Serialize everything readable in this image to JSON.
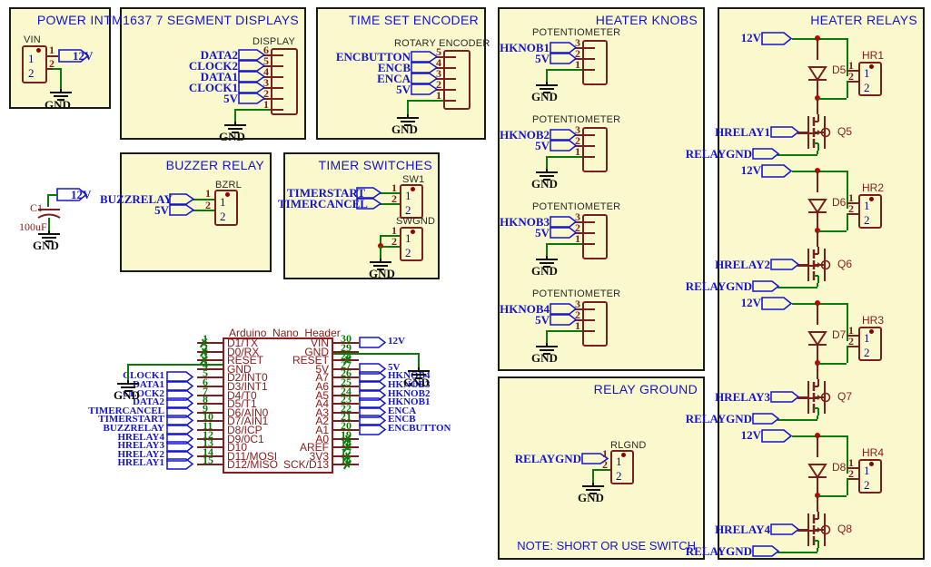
{
  "sheet": {
    "background": "#faf8cd",
    "border_color": "#1a1a1a",
    "net_color": "#1414d2",
    "wire_color": "#0a7a0a",
    "pin_color": "#7a1f1f"
  },
  "blocks": {
    "power_in": {
      "title": "POWER IN",
      "connector": {
        "name": "VIN",
        "pins": [
          "1",
          "2"
        ]
      },
      "nets": [
        "12V"
      ],
      "ground": "GND"
    },
    "displays": {
      "title": "TM1637 7 SEGMENT DISPLAYS",
      "connector": {
        "name": "DISPLAY",
        "pins": [
          "6",
          "5",
          "4",
          "3",
          "2",
          "1"
        ]
      },
      "nets": [
        "DATA2",
        "CLOCK2",
        "DATA1",
        "CLOCK1",
        "5V"
      ],
      "ground": "GND"
    },
    "encoder": {
      "title": "TIME SET ENCODER",
      "connector": {
        "name": "ROTARY ENCODER",
        "pins": [
          "5",
          "4",
          "3",
          "2",
          "1"
        ]
      },
      "nets": [
        "ENCBUTTON",
        "ENCB",
        "ENCA",
        "5V"
      ],
      "ground": "GND"
    },
    "buzzer": {
      "title": "BUZZER RELAY",
      "connector": {
        "name": "BZRL",
        "pins": [
          "1",
          "2"
        ]
      },
      "nets": [
        "BUZZRELAY",
        "5V"
      ]
    },
    "timer_switches": {
      "title": "TIMER SWITCHES",
      "connector_sw1": {
        "name": "SW1",
        "pins": [
          "1",
          "2"
        ]
      },
      "connector_swgnd": {
        "name": "SWGND",
        "pins": [
          "1",
          "2"
        ]
      },
      "nets": [
        "TIMERSTART",
        "TIMERCANCEL"
      ],
      "ground": "GND"
    },
    "decoupling": {
      "cap_ref": "C1",
      "cap_value": "100uF",
      "net": "12V",
      "ground": "GND"
    },
    "heater_knobs": {
      "title": "HEATER KNOBS",
      "device_label": "POTENTIOMETER",
      "pins": [
        "3",
        "2",
        "1"
      ],
      "ground": "GND",
      "supply_net": "5V",
      "pots": [
        {
          "net": "HKNOB1"
        },
        {
          "net": "HKNOB2"
        },
        {
          "net": "HKNOB3"
        },
        {
          "net": "HKNOB4"
        }
      ]
    },
    "relay_ground": {
      "title": "RELAY GROUND",
      "connector": {
        "name": "RLGND",
        "pins": [
          "1",
          "2"
        ]
      },
      "net": "RELAYGND",
      "ground": "GND",
      "note": "NOTE: SHORT OR USE SWITCH"
    },
    "heater_relays": {
      "title": "HEATER RELAYS",
      "supply_net": "12V",
      "ground_net": "RELAYGND",
      "stages": [
        {
          "diode": "D5",
          "mosfet": "Q5",
          "connector": "HR1",
          "gate_net": "HRELAY1",
          "pins": [
            "1",
            "2"
          ]
        },
        {
          "diode": "D6",
          "mosfet": "Q6",
          "connector": "HR2",
          "gate_net": "HRELAY2",
          "pins": [
            "1",
            "2"
          ]
        },
        {
          "diode": "D7",
          "mosfet": "Q7",
          "connector": "HR3",
          "gate_net": "HRELAY3",
          "pins": [
            "1",
            "2"
          ]
        },
        {
          "diode": "D8",
          "mosfet": "Q8",
          "connector": "HR4",
          "gate_net": "HRELAY4",
          "pins": [
            "1",
            "2"
          ]
        }
      ]
    },
    "nano": {
      "title": "Arduino_Nano_Header",
      "left_pins": [
        {
          "num": "1",
          "name": "D1/TX",
          "net": "",
          "nc": true
        },
        {
          "num": "2",
          "name": "D0/RX",
          "net": "",
          "nc": true
        },
        {
          "num": "3",
          "name": "RESET",
          "net": "",
          "nc": true
        },
        {
          "num": "4",
          "name": "GND",
          "net": "GND",
          "nc": false
        },
        {
          "num": "5",
          "name": "D2/INT0",
          "net": "CLOCK1",
          "nc": false
        },
        {
          "num": "6",
          "name": "D3/INT1",
          "net": "DATA1",
          "nc": false
        },
        {
          "num": "7",
          "name": "D4/T0",
          "net": "CLOCK2",
          "nc": false
        },
        {
          "num": "8",
          "name": "D5/T1",
          "net": "DATA2",
          "nc": false
        },
        {
          "num": "9",
          "name": "D6/AIN0",
          "net": "TIMERCANCEL",
          "nc": false
        },
        {
          "num": "10",
          "name": "D7/AIN1",
          "net": "TIMERSTART",
          "nc": false
        },
        {
          "num": "11",
          "name": "D8/ICP",
          "net": "BUZZRELAY",
          "nc": false
        },
        {
          "num": "12",
          "name": "D9/0C1",
          "net": "HRELAY4",
          "nc": false
        },
        {
          "num": "13",
          "name": "D10",
          "net": "HRELAY3",
          "nc": false
        },
        {
          "num": "14",
          "name": "D11/MOSI",
          "net": "HRELAY2",
          "nc": false
        },
        {
          "num": "15",
          "name": "D12/MISO",
          "net": "HRELAY1",
          "nc": false
        }
      ],
      "right_pins": [
        {
          "num": "30",
          "name": "VIN",
          "net": "12V",
          "nc": false
        },
        {
          "num": "29",
          "name": "GND",
          "net": "GND",
          "nc": false
        },
        {
          "num": "28",
          "name": "RESET",
          "net": "",
          "nc": true
        },
        {
          "num": "27",
          "name": "5V",
          "net": "5V",
          "nc": false
        },
        {
          "num": "26",
          "name": "A7",
          "net": "HKNOB4",
          "nc": false
        },
        {
          "num": "25",
          "name": "A6",
          "net": "HKNOB3",
          "nc": false
        },
        {
          "num": "24",
          "name": "A5",
          "net": "HKNOB2",
          "nc": false
        },
        {
          "num": "23",
          "name": "A4",
          "net": "HKNOB1",
          "nc": false
        },
        {
          "num": "22",
          "name": "A3",
          "net": "ENCA",
          "nc": false
        },
        {
          "num": "21",
          "name": "A2",
          "net": "ENCB",
          "nc": false
        },
        {
          "num": "20",
          "name": "A1",
          "net": "ENCBUTTON",
          "nc": false
        },
        {
          "num": "19",
          "name": "A0",
          "net": "",
          "nc": true
        },
        {
          "num": "18",
          "name": "AREF",
          "net": "",
          "nc": true
        },
        {
          "num": "17",
          "name": "3V3",
          "net": "",
          "nc": true
        },
        {
          "num": "16",
          "name": "SCK/D13",
          "net": "",
          "nc": true
        }
      ]
    }
  }
}
